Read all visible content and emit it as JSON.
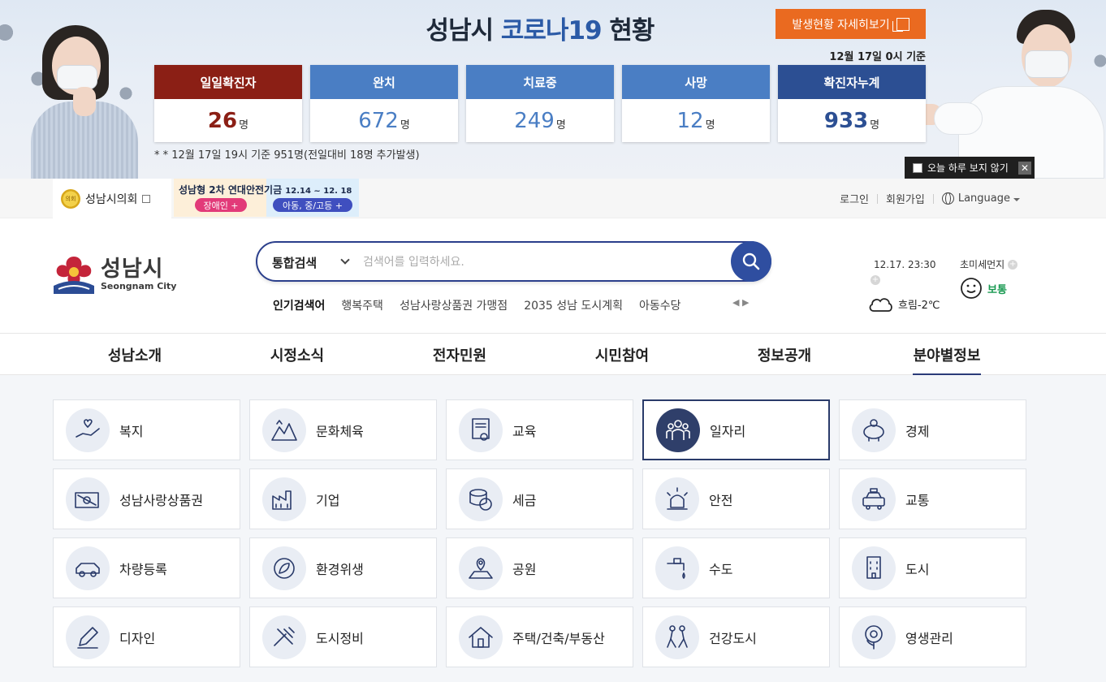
{
  "covid": {
    "title_prefix": "성남시 ",
    "title_accent": "코로나19",
    "title_suffix": " 현황",
    "detail_button": "발생현황 자세히보기",
    "as_of": "12월 17일 0시 기준",
    "stats": [
      {
        "label": "일일확진자",
        "value": "26",
        "unit": "명",
        "color": "#8b1f15",
        "num_color": "#8b1f15"
      },
      {
        "label": "완치",
        "value": "672",
        "unit": "명",
        "color": "#4a7ec4",
        "num_color": "#4a7ec4"
      },
      {
        "label": "치료중",
        "value": "249",
        "unit": "명",
        "color": "#4a7ec4",
        "num_color": "#4a7ec4"
      },
      {
        "label": "사망",
        "value": "12",
        "unit": "명",
        "color": "#4a7ec4",
        "num_color": "#4a7ec4"
      },
      {
        "label": "확진자누계",
        "value": "933",
        "unit": "명",
        "color": "#2c4f93",
        "num_color": "#2c4f93"
      }
    ],
    "note": "* * 12월 17일 19시 기준 951명(전일대비 18명 추가발생)",
    "today_close": "오늘 하루 보지 않기",
    "close_glyph": "✕"
  },
  "topbar": {
    "council": "성남시의회",
    "council_seal": "의회",
    "promo_title": "성남형 2차 연대안전기금",
    "promo_dates": "12.14 ~ 12. 18",
    "promo_pill_1": "장애인 +",
    "promo_pill_2": "아동, 중/고등 +",
    "login": "로그인",
    "signup": "회원가입",
    "language": "Language"
  },
  "header": {
    "logo_ko": "성남시",
    "logo_en": "Seongnam City",
    "search_scope": "통합검색",
    "search_placeholder": "검색어를 입력하세요.",
    "popular_label": "인기검색어",
    "popular": [
      "행복주택",
      "성남사랑상품권 가맹점",
      "2035 성남 도시계획",
      "아동수당"
    ],
    "arrows": "◀ ▶",
    "weather_time": "12.17. 23:30",
    "weather_text": "흐림-2℃",
    "dust_title": "초미세먼지",
    "dust_level": "보통",
    "plus": "+"
  },
  "gnb": [
    "성남소개",
    "시정소식",
    "전자민원",
    "시민참여",
    "정보공개",
    "분야별정보"
  ],
  "gnb_active_index": 5,
  "grid": [
    {
      "label": "복지",
      "icon": "hand-heart-icon"
    },
    {
      "label": "문화체육",
      "icon": "mountain-icon"
    },
    {
      "label": "교육",
      "icon": "certificate-icon"
    },
    {
      "label": "일자리",
      "icon": "people-icon"
    },
    {
      "label": "경제",
      "icon": "piggy-bank-icon"
    },
    {
      "label": "성남사랑상품권",
      "icon": "voucher-icon"
    },
    {
      "label": "기업",
      "icon": "factory-icon"
    },
    {
      "label": "세금",
      "icon": "coins-icon"
    },
    {
      "label": "안전",
      "icon": "siren-icon"
    },
    {
      "label": "교통",
      "icon": "taxi-icon"
    },
    {
      "label": "차량등록",
      "icon": "car-icon"
    },
    {
      "label": "환경위생",
      "icon": "recycle-leaf-icon"
    },
    {
      "label": "공원",
      "icon": "map-pin-icon"
    },
    {
      "label": "수도",
      "icon": "faucet-icon"
    },
    {
      "label": "도시",
      "icon": "building-icon"
    },
    {
      "label": "디자인",
      "icon": "pen-icon"
    },
    {
      "label": "도시정비",
      "icon": "tools-icon"
    },
    {
      "label": "주택/건축/부동산",
      "icon": "house-icon"
    },
    {
      "label": "건강도시",
      "icon": "walking-icon"
    },
    {
      "label": "영생관리",
      "icon": "flower-icon"
    }
  ],
  "grid_active_index": 3,
  "colors": {
    "navy": "#2a3b78",
    "orange": "#ea6a20",
    "accent_blue": "#2b5aa6"
  }
}
